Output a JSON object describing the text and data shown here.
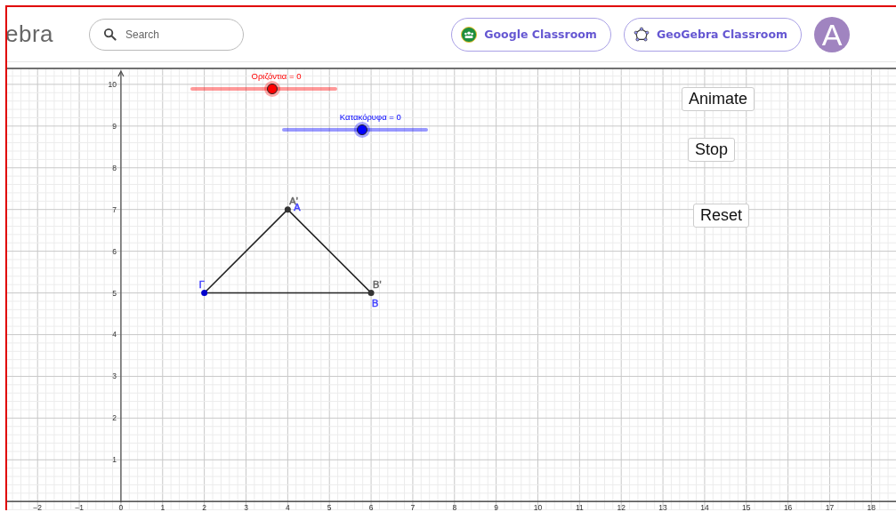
{
  "header": {
    "logo": "ebra",
    "search": {
      "placeholder": "Search"
    },
    "buttons": [
      {
        "label": "Google Classroom",
        "kind": "google"
      },
      {
        "label": "GeoGebra Classroom",
        "kind": "geogebra"
      }
    ],
    "avatar": "A"
  },
  "sliders": [
    {
      "label": "Οριζόντια = 0",
      "color": "#ff0000",
      "level": 0.56
    },
    {
      "label": "Κατακόρυφα = 0",
      "color": "#0000ff",
      "level": 0.55
    }
  ],
  "buttons": [
    "Animate",
    "Stop",
    "Reset"
  ],
  "graph": {
    "chart_data": {
      "type": "scatter",
      "xlim": [
        -2.73,
        18.59
      ],
      "ylim": [
        -0.23,
        10.36
      ],
      "xticks": [
        {
          "value": -2,
          "label": "−2"
        },
        {
          "value": -1,
          "label": "−1"
        },
        0,
        1,
        2,
        3,
        4,
        5,
        6,
        7,
        8,
        9,
        10,
        11,
        12,
        13,
        14,
        15,
        16,
        17,
        18
      ],
      "yticks": [
        1,
        2,
        3,
        4,
        5,
        6,
        7,
        8,
        9,
        10
      ],
      "grid": true,
      "x": [
        2,
        4,
        6
      ],
      "series": [
        {
          "color": "#0000cc",
          "values": [
            5,
            null,
            null
          ]
        },
        {
          "color": "#333333",
          "values": [
            null,
            7,
            5
          ]
        }
      ]
    },
    "point_labels": [
      [
        {
          "text": "Γ",
          "color": "#4444ff"
        }
      ],
      [
        {
          "text": "A'",
          "color": "#666666"
        },
        {
          "text": "A",
          "color": "#4444ff"
        }
      ],
      [
        {
          "text": "B'",
          "color": "#666666"
        },
        {
          "text": "B",
          "color": "#4444ff"
        }
      ]
    ]
  }
}
